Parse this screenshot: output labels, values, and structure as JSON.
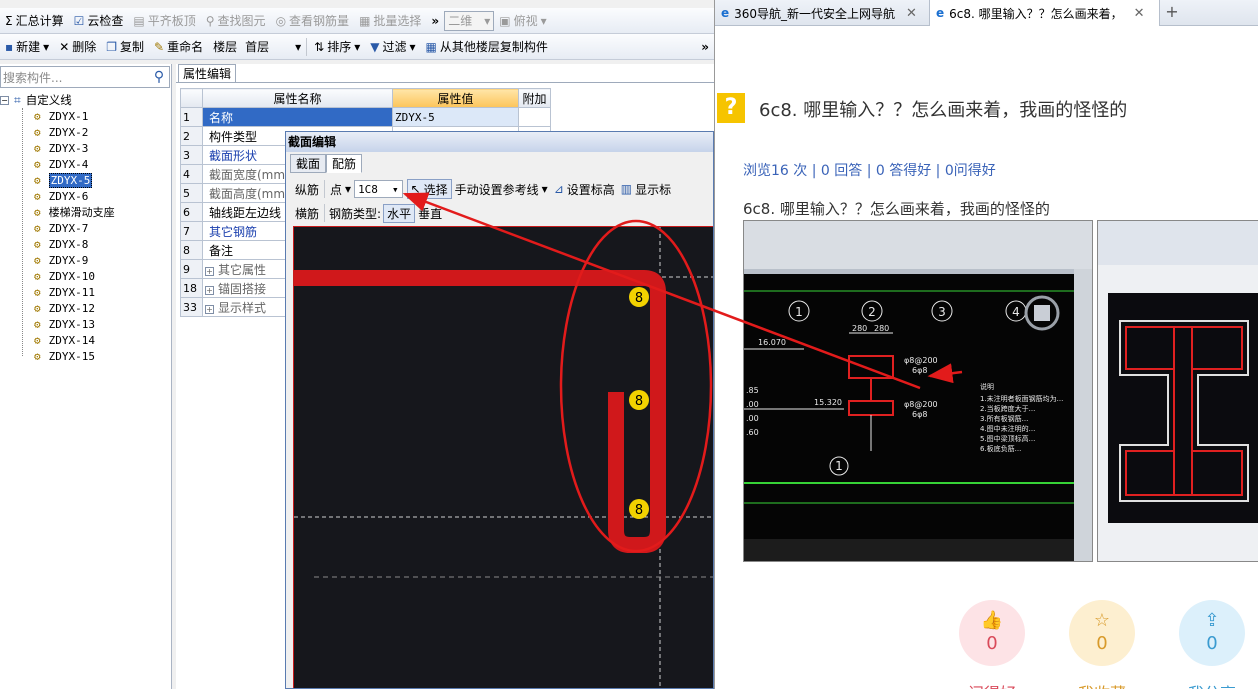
{
  "toolbar1": {
    "items": [
      {
        "icon": "sigma-icon",
        "glyph": "Σ",
        "label": "汇总计算",
        "disabled": false
      },
      {
        "icon": "cloud-check-icon",
        "glyph": "☑",
        "label": "云检查",
        "disabled": false
      },
      {
        "icon": "align-slab-icon",
        "glyph": "▤",
        "label": "平齐板顶",
        "disabled": true
      },
      {
        "icon": "find-element-icon",
        "glyph": "⚲",
        "label": "查找图元",
        "disabled": true
      },
      {
        "icon": "view-rebar-icon",
        "glyph": "◎",
        "label": "查看钢筋量",
        "disabled": true
      },
      {
        "icon": "batch-select-icon",
        "glyph": "▦",
        "label": "批量选择",
        "disabled": true
      }
    ],
    "more": "»",
    "view_mode": "二维",
    "view_angle": "俯视"
  },
  "toolbar2": {
    "new": "新建",
    "delete": "删除",
    "copy": "复制",
    "rename": "重命名",
    "floor_label": "楼层",
    "floor_value": "首层",
    "sort": "排序",
    "filter": "过滤",
    "copy_from_floor": "从其他楼层复制构件",
    "more": "»"
  },
  "left_panel": {
    "search_placeholder": "搜索构件...",
    "root_label": "自定义线",
    "items": [
      "ZDYX-1",
      "ZDYX-2",
      "ZDYX-3",
      "ZDYX-4",
      "ZDYX-5",
      "ZDYX-6",
      "楼梯滑动支座",
      "ZDYX-7",
      "ZDYX-8",
      "ZDYX-9",
      "ZDYX-10",
      "ZDYX-11",
      "ZDYX-12",
      "ZDYX-13",
      "ZDYX-14",
      "ZDYX-15"
    ],
    "selected": "ZDYX-5"
  },
  "property_panel": {
    "tab": "属性编辑",
    "headers": {
      "name": "属性名称",
      "value": "属性值",
      "extra": "附加"
    },
    "rows": [
      {
        "num": "1",
        "name": "名称",
        "value": "ZDYX-5",
        "style": "selected"
      },
      {
        "num": "2",
        "name": "构件类型",
        "value": "",
        "style": "normal"
      },
      {
        "num": "3",
        "name": "截面形状",
        "value": "",
        "style": "blue"
      },
      {
        "num": "4",
        "name": "截面宽度(mm)",
        "value": "",
        "style": "gray"
      },
      {
        "num": "5",
        "name": "截面高度(mm)",
        "value": "",
        "style": "gray"
      },
      {
        "num": "6",
        "name": "轴线距左边线",
        "value": "",
        "style": "normal"
      },
      {
        "num": "7",
        "name": "其它钢筋",
        "value": "",
        "style": "blue"
      },
      {
        "num": "8",
        "name": "备注",
        "value": "",
        "style": "normal"
      },
      {
        "num": "9",
        "name": "其它属性",
        "value": "",
        "style": "group"
      },
      {
        "num": "18",
        "name": "锚固搭接",
        "value": "",
        "style": "group"
      },
      {
        "num": "33",
        "name": "显示样式",
        "value": "",
        "style": "group"
      }
    ]
  },
  "section_editor": {
    "title": "截面编辑",
    "tabs": [
      {
        "label": "截面",
        "active": false
      },
      {
        "label": "配筋",
        "active": true
      }
    ],
    "tb1": {
      "longitudinal": "纵筋",
      "point": "点",
      "spec": "1C8",
      "select": "选择",
      "manual_ref": "手动设置参考线",
      "set_mark": "设置标高",
      "show": "显示标"
    },
    "tb2": {
      "transverse": "横筋",
      "rebar_type_label": "钢筋类型:",
      "horizontal": "水平",
      "vertical": "垂直"
    },
    "rebar_markers": [
      "8",
      "8",
      "8"
    ]
  },
  "browser": {
    "tabs": [
      {
        "label": "360导航_新一代安全上网导航",
        "active": false
      },
      {
        "label": "6c8. 哪里输入？？怎么画来着，",
        "active": true
      }
    ],
    "new_tab": "+",
    "question": {
      "badge": "?",
      "title": "6c8. 哪里输入？？怎么画来着，我画的怪怪的",
      "stats": "浏览16 次 | 0 回答 | 0 答得好 | 0问得好",
      "body": "6c8. 哪里输入？？怎么画来着，我画的怪怪的"
    },
    "actions": [
      {
        "id": "like",
        "icon": "thumbs-up-icon",
        "glyph": "👍",
        "count": "0",
        "label": "问得好"
      },
      {
        "id": "fav",
        "icon": "star-icon",
        "glyph": "☆",
        "count": "0",
        "label": "我收藏"
      },
      {
        "id": "share",
        "icon": "share-icon",
        "glyph": "⇪",
        "count": "0",
        "label": "我分享"
      }
    ],
    "thumb1": {
      "axis_labels": [
        "1",
        "2",
        "3",
        "4"
      ],
      "dims": [
        "280",
        "280",
        "16.070",
        "15.320",
        "φ8@200",
        "6φ8",
        "φ8@200",
        "6φ8"
      ],
      "levels": [
        ".85",
        ".00",
        ".00",
        ".60"
      ],
      "note_title": "说明",
      "notes": [
        "1.未注明者板面钢筋均为...",
        "2.当板跨度大于...",
        "3.所有板钢筋...",
        "4.图中未注明的...",
        "5.图中梁顶标高...",
        "6.板底负筋..."
      ]
    }
  },
  "colors": {
    "accent_red": "#e21b1b",
    "rebar_yellow": "#f2d200",
    "canvas_bg": "#16171c"
  }
}
